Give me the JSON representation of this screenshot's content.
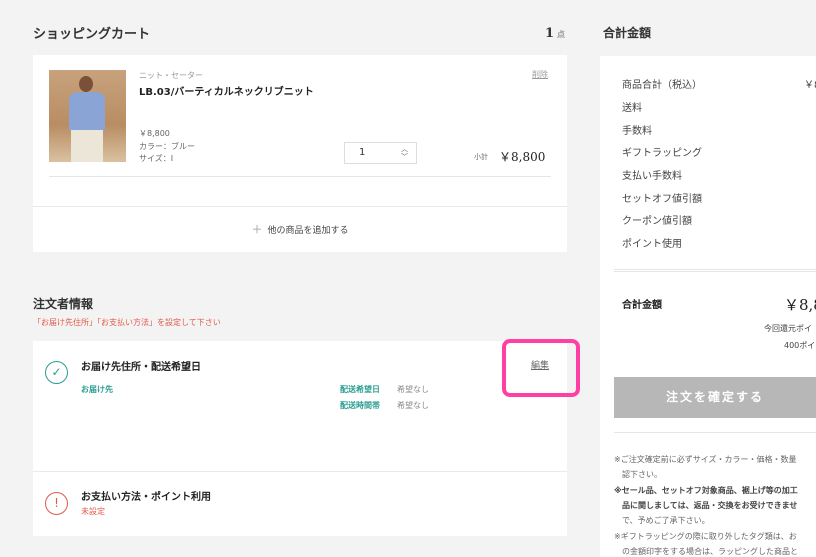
{
  "cart": {
    "title": "ショッピングカート",
    "count": "1",
    "count_unit": "点",
    "item": {
      "category": "ニット・セーター",
      "name": "LB.03/バーティカルネックリブニット",
      "delete_label": "削除",
      "price": "￥8,800",
      "color": "カラー：ブルー",
      "size": "サイズ：I",
      "quantity": "1",
      "subtotal_label": "小計",
      "subtotal_value": "￥8,800"
    },
    "add_more_icon": "plus-icon",
    "add_more_label": "他の商品を追加する"
  },
  "orderer": {
    "title": "注文者情報",
    "warning": "「お届け先住所」「お支払い方法」を設定して下さい",
    "delivery": {
      "title": "お届け先住所・配送希望日",
      "edit_label": "編集",
      "destination_label": "お届け先",
      "date_label": "配送希望日",
      "date_value": "希望なし",
      "time_label": "配送時間帯",
      "time_value": "希望なし"
    },
    "payment": {
      "title": "お支払い方法・ポイント利用",
      "status": "未設定"
    }
  },
  "summary": {
    "title": "合計金額",
    "items": [
      "商品合計（税込）",
      "送料",
      "手数料",
      "ギフトラッピング",
      "支払い手数料",
      "セットオフ値引額",
      "クーポン値引額",
      "ポイント使用"
    ],
    "items_first_value": "￥8",
    "total_label": "合計金額",
    "total_value": "￥8,8",
    "points_line1": "今回還元ポイ",
    "points_line2": "400ポイ",
    "confirm_label": "注文を確定する",
    "notes": [
      "※ご注文確定前に必ずサイズ・カラー・価格・数量",
      "　認下さい。",
      "※セール品、セットオフ対象商品、裾上げ等の加工",
      "　品に関しましては、返品・交換をお受けできませ",
      "　で、予めご了承下さい。",
      "※ギフトラッピングの際に取り外したタグ類は、お",
      "　の金額印字をする場合は、ラッピングした商品と"
    ]
  },
  "colors": {
    "accent_teal": "#2a9d8f",
    "warning_red": "#e05a4a",
    "highlight_pink": "#ff3fa4",
    "confirm_gray": "#b7b7b7"
  }
}
